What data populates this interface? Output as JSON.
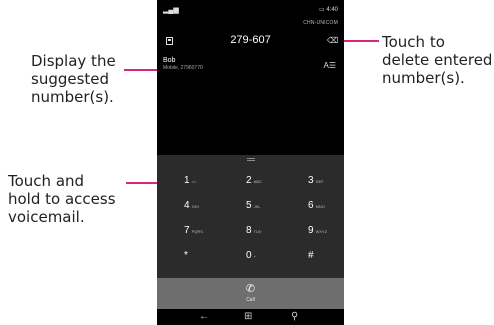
{
  "callouts": {
    "suggested": [
      "Display the",
      "suggested",
      "number(s)."
    ],
    "voicemail": [
      "Touch and",
      "hold to access",
      "voicemail."
    ],
    "delete": [
      "Touch to",
      "delete entered",
      "number(s)."
    ]
  },
  "colors": {
    "accent": "#d9267d",
    "keypad_bg": "#2b2b2b",
    "call_bar": "#6e6e6e"
  },
  "status": {
    "time": "4:40",
    "carrier": "CHN-UNICOM"
  },
  "dialer": {
    "entered_number": "279-607",
    "suggestion": {
      "name": "Bob",
      "detail": "Mobile, 27960770"
    },
    "keys": [
      {
        "digit": "1",
        "sub": "⌂⌂"
      },
      {
        "digit": "2",
        "sub": "ABC"
      },
      {
        "digit": "3",
        "sub": "DEF"
      },
      {
        "digit": "4",
        "sub": "GHI"
      },
      {
        "digit": "5",
        "sub": "JKL"
      },
      {
        "digit": "6",
        "sub": "MNO"
      },
      {
        "digit": "7",
        "sub": "PQRS"
      },
      {
        "digit": "8",
        "sub": "TUV"
      },
      {
        "digit": "9",
        "sub": "WXYZ"
      },
      {
        "digit": "*",
        "sub": ""
      },
      {
        "digit": "0",
        "sub": "+"
      },
      {
        "digit": "#",
        "sub": ""
      }
    ],
    "call_label": "Call"
  },
  "icons": [
    "signal-icon",
    "battery-icon",
    "save-contact-icon",
    "backspace-icon",
    "contact-list-icon",
    "phone-icon",
    "back-icon",
    "windows-icon",
    "search-icon"
  ]
}
